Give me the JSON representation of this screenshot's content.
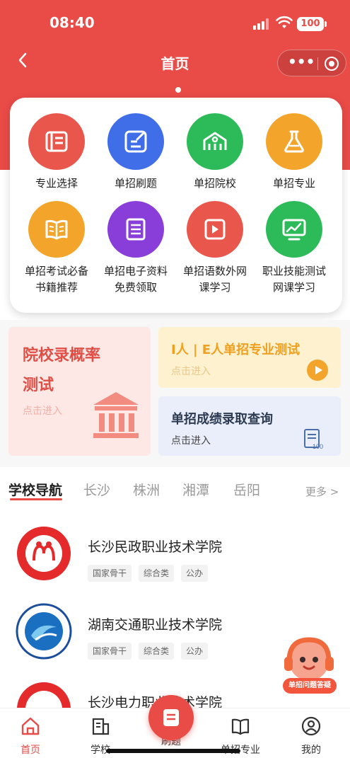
{
  "status_bar": {
    "time": "08:40",
    "battery": "100"
  },
  "nav": {
    "back_icon": "chevron-left-icon",
    "title": "首页",
    "more_icon": "more-icon",
    "close_icon": "target-icon"
  },
  "colors": {
    "brand": "#e94b47",
    "orange": "#f3a52b",
    "blue": "#3f6ee8",
    "green": "#2dbb5a",
    "purple": "#8a3ed9"
  },
  "grid": [
    {
      "label": "专业选择",
      "icon": "list-icon",
      "color": "#e9574c"
    },
    {
      "label": "单招刷题",
      "icon": "edit-icon",
      "color": "#3f6ee8"
    },
    {
      "label": "单招院校",
      "icon": "school-icon",
      "color": "#2dbb5a"
    },
    {
      "label": "单招专业",
      "icon": "flask-icon",
      "color": "#f3a52b"
    },
    {
      "label": "单招考试必备书籍推荐",
      "line1": "单招考试必备",
      "line2": "书籍推荐",
      "icon": "book-icon",
      "color": "#f3a52b"
    },
    {
      "label": "单招电子资料免费领取",
      "line1": "单招电子资料",
      "line2": "免费领取",
      "icon": "document-icon",
      "color": "#8a3ed9"
    },
    {
      "label": "单招语数外网课学习",
      "line1": "单招语数外网",
      "line2": "课学习",
      "icon": "video-icon",
      "color": "#e9574c"
    },
    {
      "label": "职业技能测试网课学习",
      "line1": "职业技能测试",
      "line2": "网课学习",
      "icon": "monitor-icon",
      "color": "#2dbb5a"
    }
  ],
  "promo": {
    "left": {
      "title_line1": "院校录概率",
      "title_line2": "测试",
      "sub": "点击进入",
      "icon": "bank-icon"
    },
    "right_top": {
      "title": "I人 | E人单招专业测试",
      "sub": "点击进入",
      "icon": "play-icon"
    },
    "right_bottom": {
      "title": "单招成绩录取查询",
      "sub": "点击进入",
      "icon": "score-icon"
    }
  },
  "school_nav": {
    "tabs": [
      "学校导航",
      "长沙",
      "株洲",
      "湘潭",
      "岳阳"
    ],
    "active": "学校导航",
    "more": "更多 >"
  },
  "schools": [
    {
      "name": "长沙民政职业技术学院",
      "tags": [
        "国家骨干",
        "综合类",
        "公办"
      ]
    },
    {
      "name": "湖南交通职业技术学院",
      "tags": [
        "国家骨干",
        "综合类",
        "公办"
      ]
    },
    {
      "name": "长沙电力职业技术学院",
      "tags": []
    }
  ],
  "assistant": {
    "label": "单招问题答疑",
    "icon": "headset-mascot-icon"
  },
  "tabbar": [
    {
      "label": "首页",
      "icon": "home-icon",
      "active": true
    },
    {
      "label": "学校",
      "icon": "building-icon",
      "active": false
    },
    {
      "label": "刷题",
      "icon": "note-icon",
      "active": false
    },
    {
      "label": "单招专业",
      "icon": "open-book-icon",
      "active": false
    },
    {
      "label": "我的",
      "icon": "user-icon",
      "active": false
    }
  ]
}
